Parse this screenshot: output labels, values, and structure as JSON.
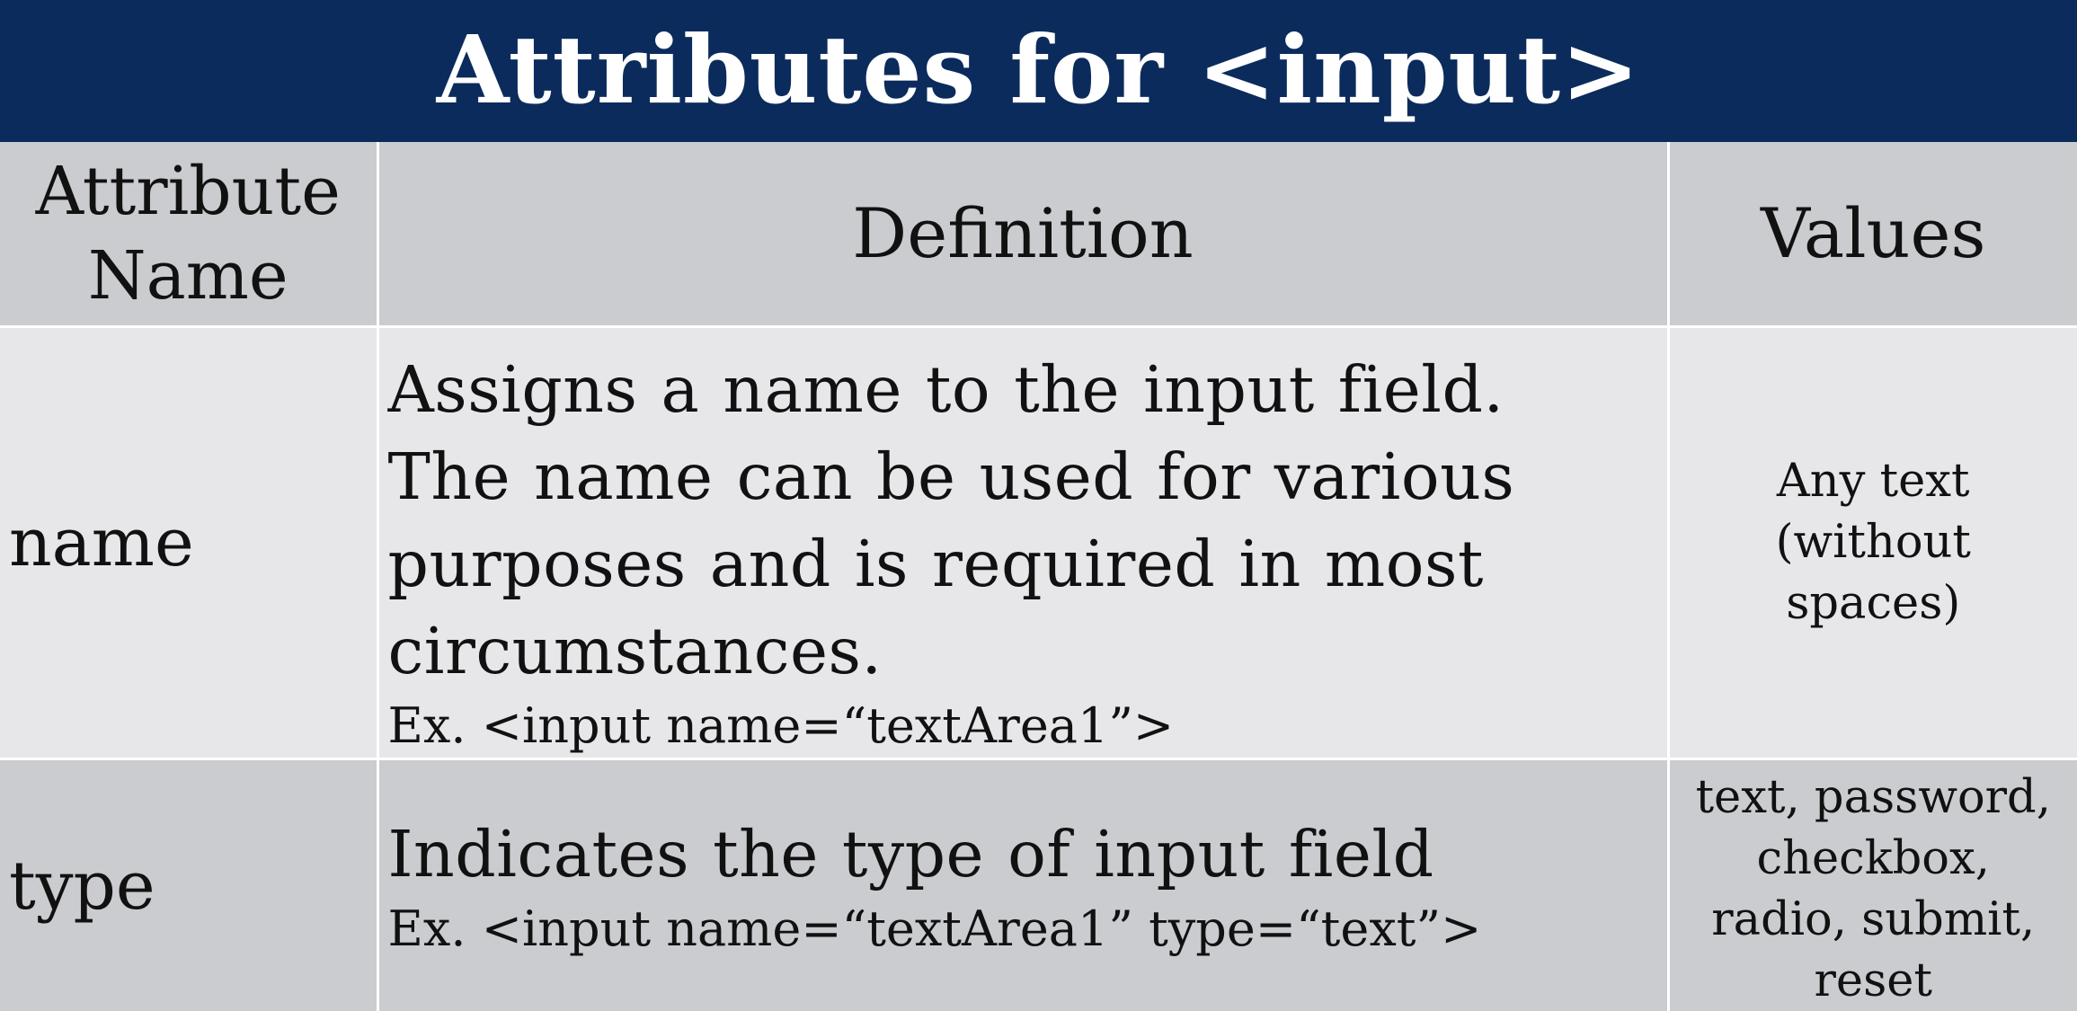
{
  "slide": {
    "title": "Attributes for <input>",
    "colors": {
      "title_bar": "#0b2b5c",
      "header_row": "#cbccd0",
      "odd_row": "#e7e7e9",
      "even_row": "#cbccd0"
    }
  },
  "table": {
    "headers": {
      "attribute_line1": "Attribute",
      "attribute_line2": "Name",
      "definition": "Definition",
      "values": "Values"
    },
    "rows": [
      {
        "attribute": "name",
        "definition_lines": [
          "Assigns a name to the input field.",
          "The name can be used for various",
          "purposes and is required in most",
          "circumstances."
        ],
        "example": "Ex.  <input name=“textArea1”>",
        "values_lines": [
          "Any text",
          "(without",
          "spaces)"
        ]
      },
      {
        "attribute": "type",
        "definition_lines": [
          "Indicates the type of input field"
        ],
        "example": "Ex.  <input name=“textArea1” type=“text”>",
        "values_lines": [
          "text, password,",
          "checkbox,",
          "radio, submit,",
          "reset"
        ]
      }
    ]
  }
}
